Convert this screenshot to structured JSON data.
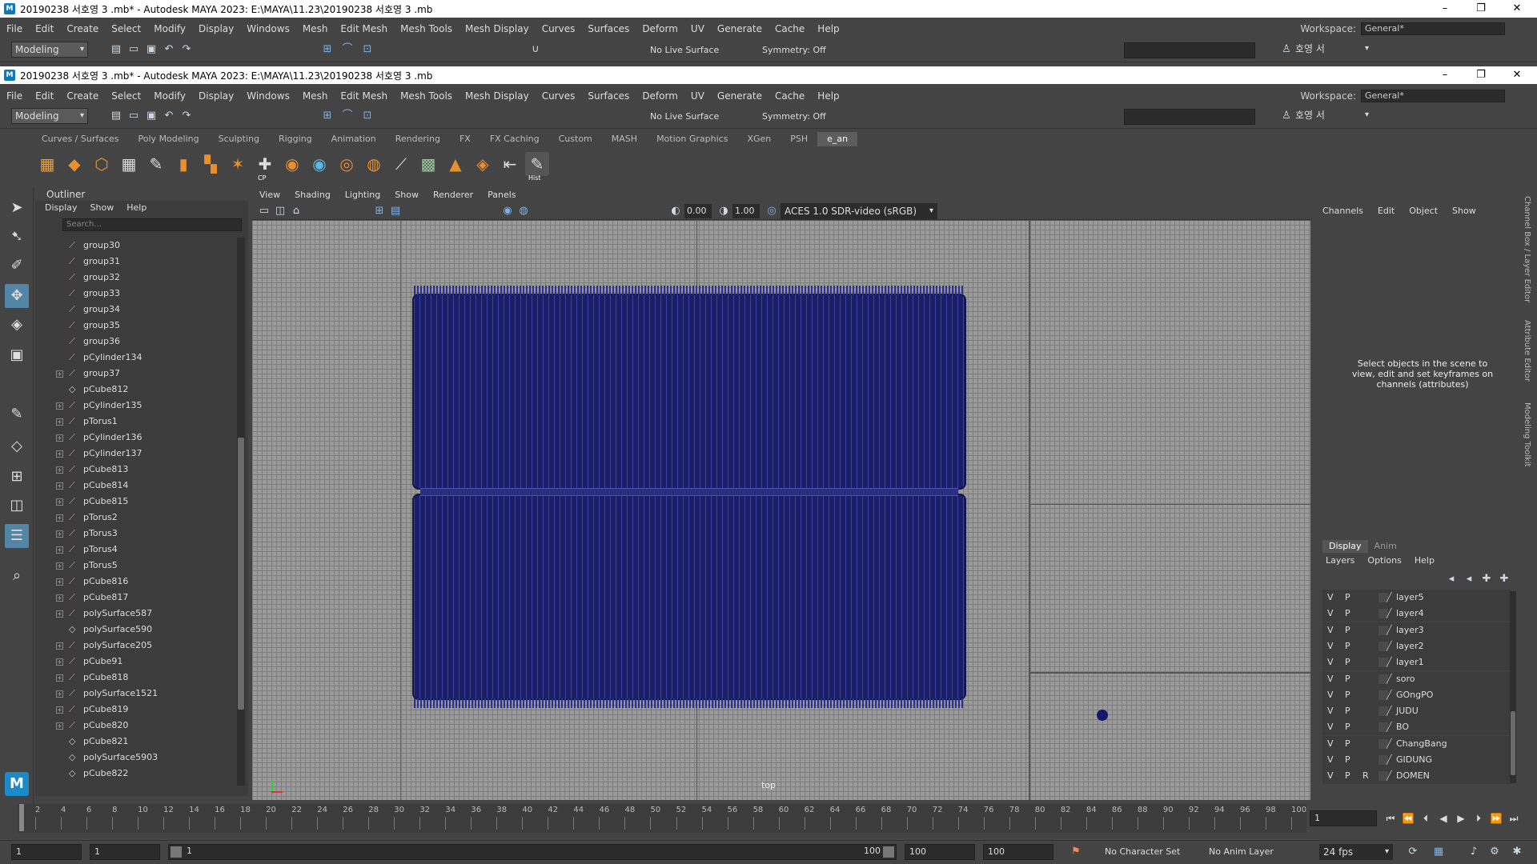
{
  "outer_window": {
    "title": "20190238 서호영 3 .mb* - Autodesk MAYA 2023: E:\\MAYA\\11.23\\20190238 서호영 3 .mb",
    "minimize": "–",
    "maximize": "❐",
    "close": "✕"
  },
  "inner_window": {
    "title": "20190238 서호영 3 .mb* - Autodesk MAYA 2023: E:\\MAYA\\11.23\\20190238 서호영 3 .mb",
    "minimize": "–",
    "maximize": "❐",
    "close": "✕"
  },
  "menus": [
    "File",
    "Edit",
    "Create",
    "Select",
    "Modify",
    "Display",
    "Windows",
    "Mesh",
    "Edit Mesh",
    "Mesh Tools",
    "Mesh Display",
    "Curves",
    "Surfaces",
    "Deform",
    "UV",
    "Generate",
    "Cache",
    "Help"
  ],
  "workspace": {
    "label": "Workspace:",
    "value": "General*"
  },
  "status_line": {
    "mode": "Modeling",
    "live_surface": "No Live Surface",
    "symmetry": "Symmetry: Off",
    "user": "호영 서"
  },
  "shelf_tabs": [
    "Curves / Surfaces",
    "Poly Modeling",
    "Sculpting",
    "Rigging",
    "Animation",
    "Rendering",
    "FX",
    "FX Caching",
    "Custom",
    "MASH",
    "Motion Graphics",
    "XGen",
    "PSH",
    "e_an"
  ],
  "shelf_active": "e_an",
  "shelf_labels": {
    "cp": "CP",
    "hist": "Hist"
  },
  "outliner": {
    "title": "Outliner",
    "menu": [
      "Display",
      "Show",
      "Help"
    ],
    "search_placeholder": "Search...",
    "items": [
      {
        "name": "group30",
        "expandable": false
      },
      {
        "name": "group31",
        "expandable": false
      },
      {
        "name": "group32",
        "expandable": false
      },
      {
        "name": "group33",
        "expandable": false
      },
      {
        "name": "group34",
        "expandable": false
      },
      {
        "name": "group35",
        "expandable": false
      },
      {
        "name": "group36",
        "expandable": false
      },
      {
        "name": "pCylinder134",
        "expandable": false
      },
      {
        "name": "group37",
        "expandable": true
      },
      {
        "name": "pCube812",
        "expandable": false
      },
      {
        "name": "pCylinder135",
        "expandable": true
      },
      {
        "name": "pTorus1",
        "expandable": true
      },
      {
        "name": "pCylinder136",
        "expandable": true
      },
      {
        "name": "pCylinder137",
        "expandable": true
      },
      {
        "name": "pCube813",
        "expandable": true
      },
      {
        "name": "pCube814",
        "expandable": true
      },
      {
        "name": "pCube815",
        "expandable": true
      },
      {
        "name": "pTorus2",
        "expandable": true
      },
      {
        "name": "pTorus3",
        "expandable": true
      },
      {
        "name": "pTorus4",
        "expandable": true
      },
      {
        "name": "pTorus5",
        "expandable": true
      },
      {
        "name": "pCube816",
        "expandable": true
      },
      {
        "name": "pCube817",
        "expandable": true
      },
      {
        "name": "polySurface587",
        "expandable": true
      },
      {
        "name": "polySurface590",
        "expandable": false
      },
      {
        "name": "polySurface205",
        "expandable": true
      },
      {
        "name": "pCube91",
        "expandable": true
      },
      {
        "name": "pCube818",
        "expandable": true
      },
      {
        "name": "polySurface1521",
        "expandable": true
      },
      {
        "name": "pCube819",
        "expandable": true
      },
      {
        "name": "pCube820",
        "expandable": true
      },
      {
        "name": "pCube821",
        "expandable": false
      },
      {
        "name": "polySurface5903",
        "expandable": false
      },
      {
        "name": "pCube822",
        "expandable": false
      }
    ]
  },
  "viewport": {
    "menu": [
      "View",
      "Shading",
      "Lighting",
      "Show",
      "Renderer",
      "Panels"
    ],
    "exposure": "0.00",
    "gamma": "1.00",
    "color_space": "ACES 1.0 SDR-video (sRGB)",
    "camera_label": "top"
  },
  "channel_box": {
    "menu": [
      "Channels",
      "Edit",
      "Object",
      "Show"
    ],
    "message": "Select objects in the scene to view, edit and set keyframes on channels (attributes)"
  },
  "side_tabs": [
    "Channel Box / Layer Editor",
    "Attribute Editor",
    "Modeling Toolkit"
  ],
  "layer_editor": {
    "tabs": [
      "Display",
      "Anim"
    ],
    "menu": [
      "Layers",
      "Options",
      "Help"
    ],
    "layers": [
      {
        "v": "V",
        "p": "P",
        "r": "",
        "name": "layer5"
      },
      {
        "v": "V",
        "p": "P",
        "r": "",
        "name": "layer4"
      },
      {
        "v": "V",
        "p": "P",
        "r": "",
        "name": "layer3"
      },
      {
        "v": "V",
        "p": "P",
        "r": "",
        "name": "layer2"
      },
      {
        "v": "V",
        "p": "P",
        "r": "",
        "name": "layer1"
      },
      {
        "v": "V",
        "p": "P",
        "r": "",
        "name": "soro"
      },
      {
        "v": "V",
        "p": "P",
        "r": "",
        "name": "GOngPO"
      },
      {
        "v": "V",
        "p": "P",
        "r": "",
        "name": "JUDU"
      },
      {
        "v": "V",
        "p": "P",
        "r": "",
        "name": "BO"
      },
      {
        "v": "V",
        "p": "P",
        "r": "",
        "name": "ChangBang"
      },
      {
        "v": "V",
        "p": "P",
        "r": "",
        "name": "GIDUNG"
      },
      {
        "v": "V",
        "p": "P",
        "r": "R",
        "name": "DOMEN"
      }
    ]
  },
  "timeline": {
    "ticks": [
      "2",
      "4",
      "6",
      "8",
      "10",
      "12",
      "14",
      "16",
      "18",
      "20",
      "22",
      "24",
      "26",
      "28",
      "30",
      "32",
      "34",
      "36",
      "38",
      "40",
      "42",
      "44",
      "46",
      "48",
      "50",
      "52",
      "54",
      "56",
      "58",
      "60",
      "62",
      "64",
      "66",
      "68",
      "70",
      "72",
      "74",
      "76",
      "78",
      "80",
      "82",
      "84",
      "86",
      "88",
      "90",
      "92",
      "94",
      "96",
      "98",
      "100"
    ],
    "current_frame": "1"
  },
  "range": {
    "start": "1",
    "playback_start": "1",
    "slider_start": "1",
    "slider_end": "100",
    "playback_end": "100",
    "end": "100",
    "character_set": "No Character Set",
    "anim_layer": "No Anim Layer",
    "fps": "24 fps"
  }
}
